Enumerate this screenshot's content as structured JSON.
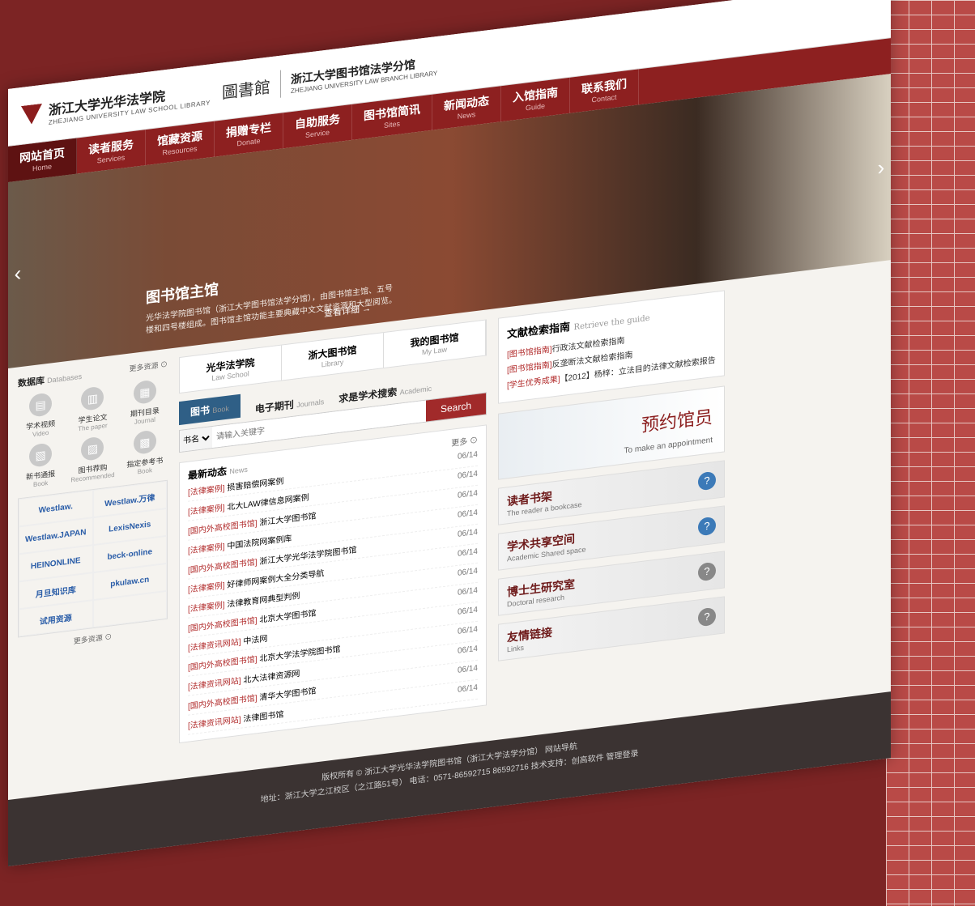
{
  "header": {
    "school_cn": "浙江大学光华法学院",
    "school_en": "ZHEJIANG UNIVERSITY LAW SCHOOL LIBRARY",
    "library_word": "圖書館",
    "branch_cn": "浙江大学图书馆法学分馆",
    "branch_en": "ZHEJIANG UNIVERSITY LAW BRANCH LIBRARY"
  },
  "nav": {
    "items": [
      {
        "cn": "网站首页",
        "en": "Home"
      },
      {
        "cn": "读者服务",
        "en": "Services"
      },
      {
        "cn": "馆藏资源",
        "en": "Resources"
      },
      {
        "cn": "捐赠专栏",
        "en": "Donate"
      },
      {
        "cn": "自助服务",
        "en": "Service"
      },
      {
        "cn": "图书馆简讯",
        "en": "Sites"
      },
      {
        "cn": "新闻动态",
        "en": "News"
      },
      {
        "cn": "入馆指南",
        "en": "Guide"
      },
      {
        "cn": "联系我们",
        "en": "Contact"
      }
    ]
  },
  "banner": {
    "title": "图书馆主馆",
    "desc": "光华法学院图书馆（浙江大学图书馆法学分馆），由图书馆主馆、五号楼和四号楼组成。图书馆主馆功能主要典藏中文文献资源和大型阅览。",
    "more": "查看详细 →"
  },
  "left": {
    "db_title_cn": "数据库",
    "db_title_en": "Databases",
    "more": "更多资源 ⊙",
    "db_items": [
      {
        "cn": "学术视频",
        "en": "Video"
      },
      {
        "cn": "学生论文",
        "en": "The paper"
      },
      {
        "cn": "期刊目录",
        "en": "Journal"
      },
      {
        "cn": "新书通报",
        "en": "Book"
      },
      {
        "cn": "图书荐购",
        "en": "Recommended"
      },
      {
        "cn": "指定参考书",
        "en": "Book"
      }
    ],
    "resources": [
      "Westlaw.",
      "Westlaw.万律",
      "Westlaw.JAPAN",
      "LexisNexis",
      "HEINONLINE",
      "beck-online",
      "月旦知识库",
      "pkulaw.cn",
      "试用资源",
      ""
    ],
    "more_bottom": "更多资源 ⊙"
  },
  "middle": {
    "top_tabs": [
      {
        "cn": "光华法学院",
        "en": "Law School"
      },
      {
        "cn": "浙大图书馆",
        "en": "Library"
      },
      {
        "cn": "我的图书馆",
        "en": "My Law"
      }
    ],
    "search_tabs": [
      {
        "cn": "图书",
        "en": "Book"
      },
      {
        "cn": "电子期刊",
        "en": "Journals"
      },
      {
        "cn": "求是学术搜索",
        "en": "Academic"
      }
    ],
    "search_select": "书名",
    "search_placeholder": "请输入关键字",
    "search_button": "Search",
    "news_title_cn": "最新动态",
    "news_title_en": "News",
    "news_more": "更多 ⊙",
    "news": [
      {
        "cat": "[法律案例]",
        "title": "损害赔偿网案例",
        "date": "06/14"
      },
      {
        "cat": "[法律案例]",
        "title": "北大LAW律信息网案例",
        "date": "06/14"
      },
      {
        "cat": "[国内外高校图书馆]",
        "title": "浙江大学图书馆",
        "date": "06/14"
      },
      {
        "cat": "[法律案例]",
        "title": "中国法院网案例库",
        "date": "06/14"
      },
      {
        "cat": "[国内外高校图书馆]",
        "title": "浙江大学光华法学院图书馆",
        "date": "06/14"
      },
      {
        "cat": "[法律案例]",
        "title": "好律师网案例大全分类导航",
        "date": "06/14"
      },
      {
        "cat": "[法律案例]",
        "title": "法律教育网典型判例",
        "date": "06/14"
      },
      {
        "cat": "[国内外高校图书馆]",
        "title": "北京大学图书馆",
        "date": "06/14"
      },
      {
        "cat": "[法律资讯网站]",
        "title": "中法网",
        "date": "06/14"
      },
      {
        "cat": "[国内外高校图书馆]",
        "title": "北京大学法学院图书馆",
        "date": "06/14"
      },
      {
        "cat": "[法律资讯网站]",
        "title": "北大法律资源网",
        "date": "06/14"
      },
      {
        "cat": "[国内外高校图书馆]",
        "title": "清华大学图书馆",
        "date": "06/14"
      },
      {
        "cat": "[法律资讯网站]",
        "title": "法律图书馆",
        "date": "06/14"
      }
    ]
  },
  "right": {
    "guide_title_cn": "文献检索指南",
    "guide_title_en": "Retrieve the guide",
    "guide_items": [
      {
        "tag": "[图书馆指南]",
        "text": "行政法文献检索指南"
      },
      {
        "tag": "[图书馆指南]",
        "text": "反垄断法文献检索指南"
      },
      {
        "tag": "[学生优秀成果]",
        "text": "【2012】杨梓：立法目的法律文献检索报告"
      }
    ],
    "appointment_cn": "预约馆员",
    "appointment_en": "To make an appointment",
    "cards": [
      {
        "cn": "读者书架",
        "en": "The reader a bookcase"
      },
      {
        "cn": "学术共享空间",
        "en": "Academic Shared space"
      },
      {
        "cn": "博士生研究室",
        "en": "Doctoral research"
      },
      {
        "cn": "友情链接",
        "en": "Links"
      }
    ]
  },
  "footer": {
    "line1": "版权所有 © 浙江大学光华法学院图书馆（浙江大学法学分馆） 网站导航",
    "line2": "地址：浙江大学之江校区（之江路51号） 电话：0571-86592715 86592716 技术支持：创高软件 管理登录"
  }
}
